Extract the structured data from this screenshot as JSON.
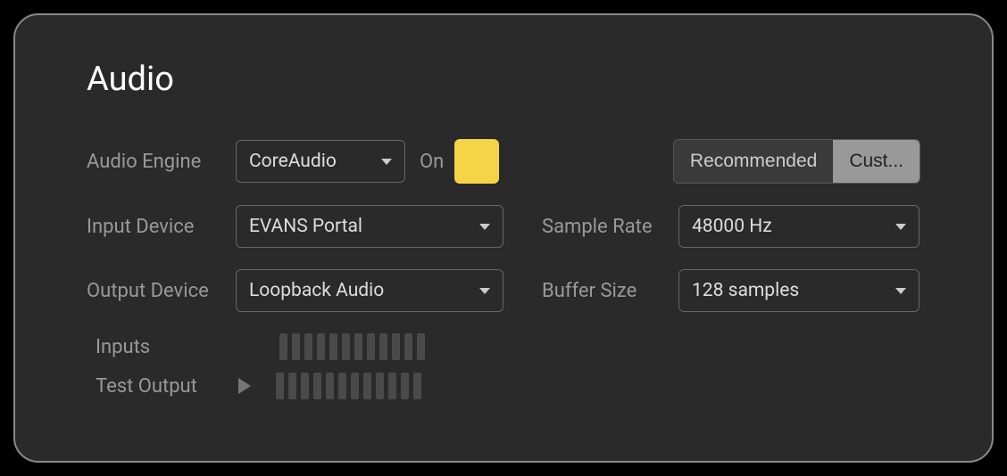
{
  "title": "Audio",
  "engine": {
    "label": "Audio Engine",
    "value": "CoreAudio",
    "status": "On",
    "swatch_color": "#f5d547"
  },
  "preset": {
    "recommended": "Recommended",
    "custom": "Cust..."
  },
  "input_device": {
    "label": "Input Device",
    "value": "EVANS Portal"
  },
  "output_device": {
    "label": "Output Device",
    "value": "Loopback Audio"
  },
  "sample_rate": {
    "label": "Sample Rate",
    "value": "48000 Hz"
  },
  "buffer_size": {
    "label": "Buffer Size",
    "value": "128 samples"
  },
  "meters": {
    "inputs_label": "Inputs",
    "test_output_label": "Test Output",
    "bar_count": 12
  }
}
